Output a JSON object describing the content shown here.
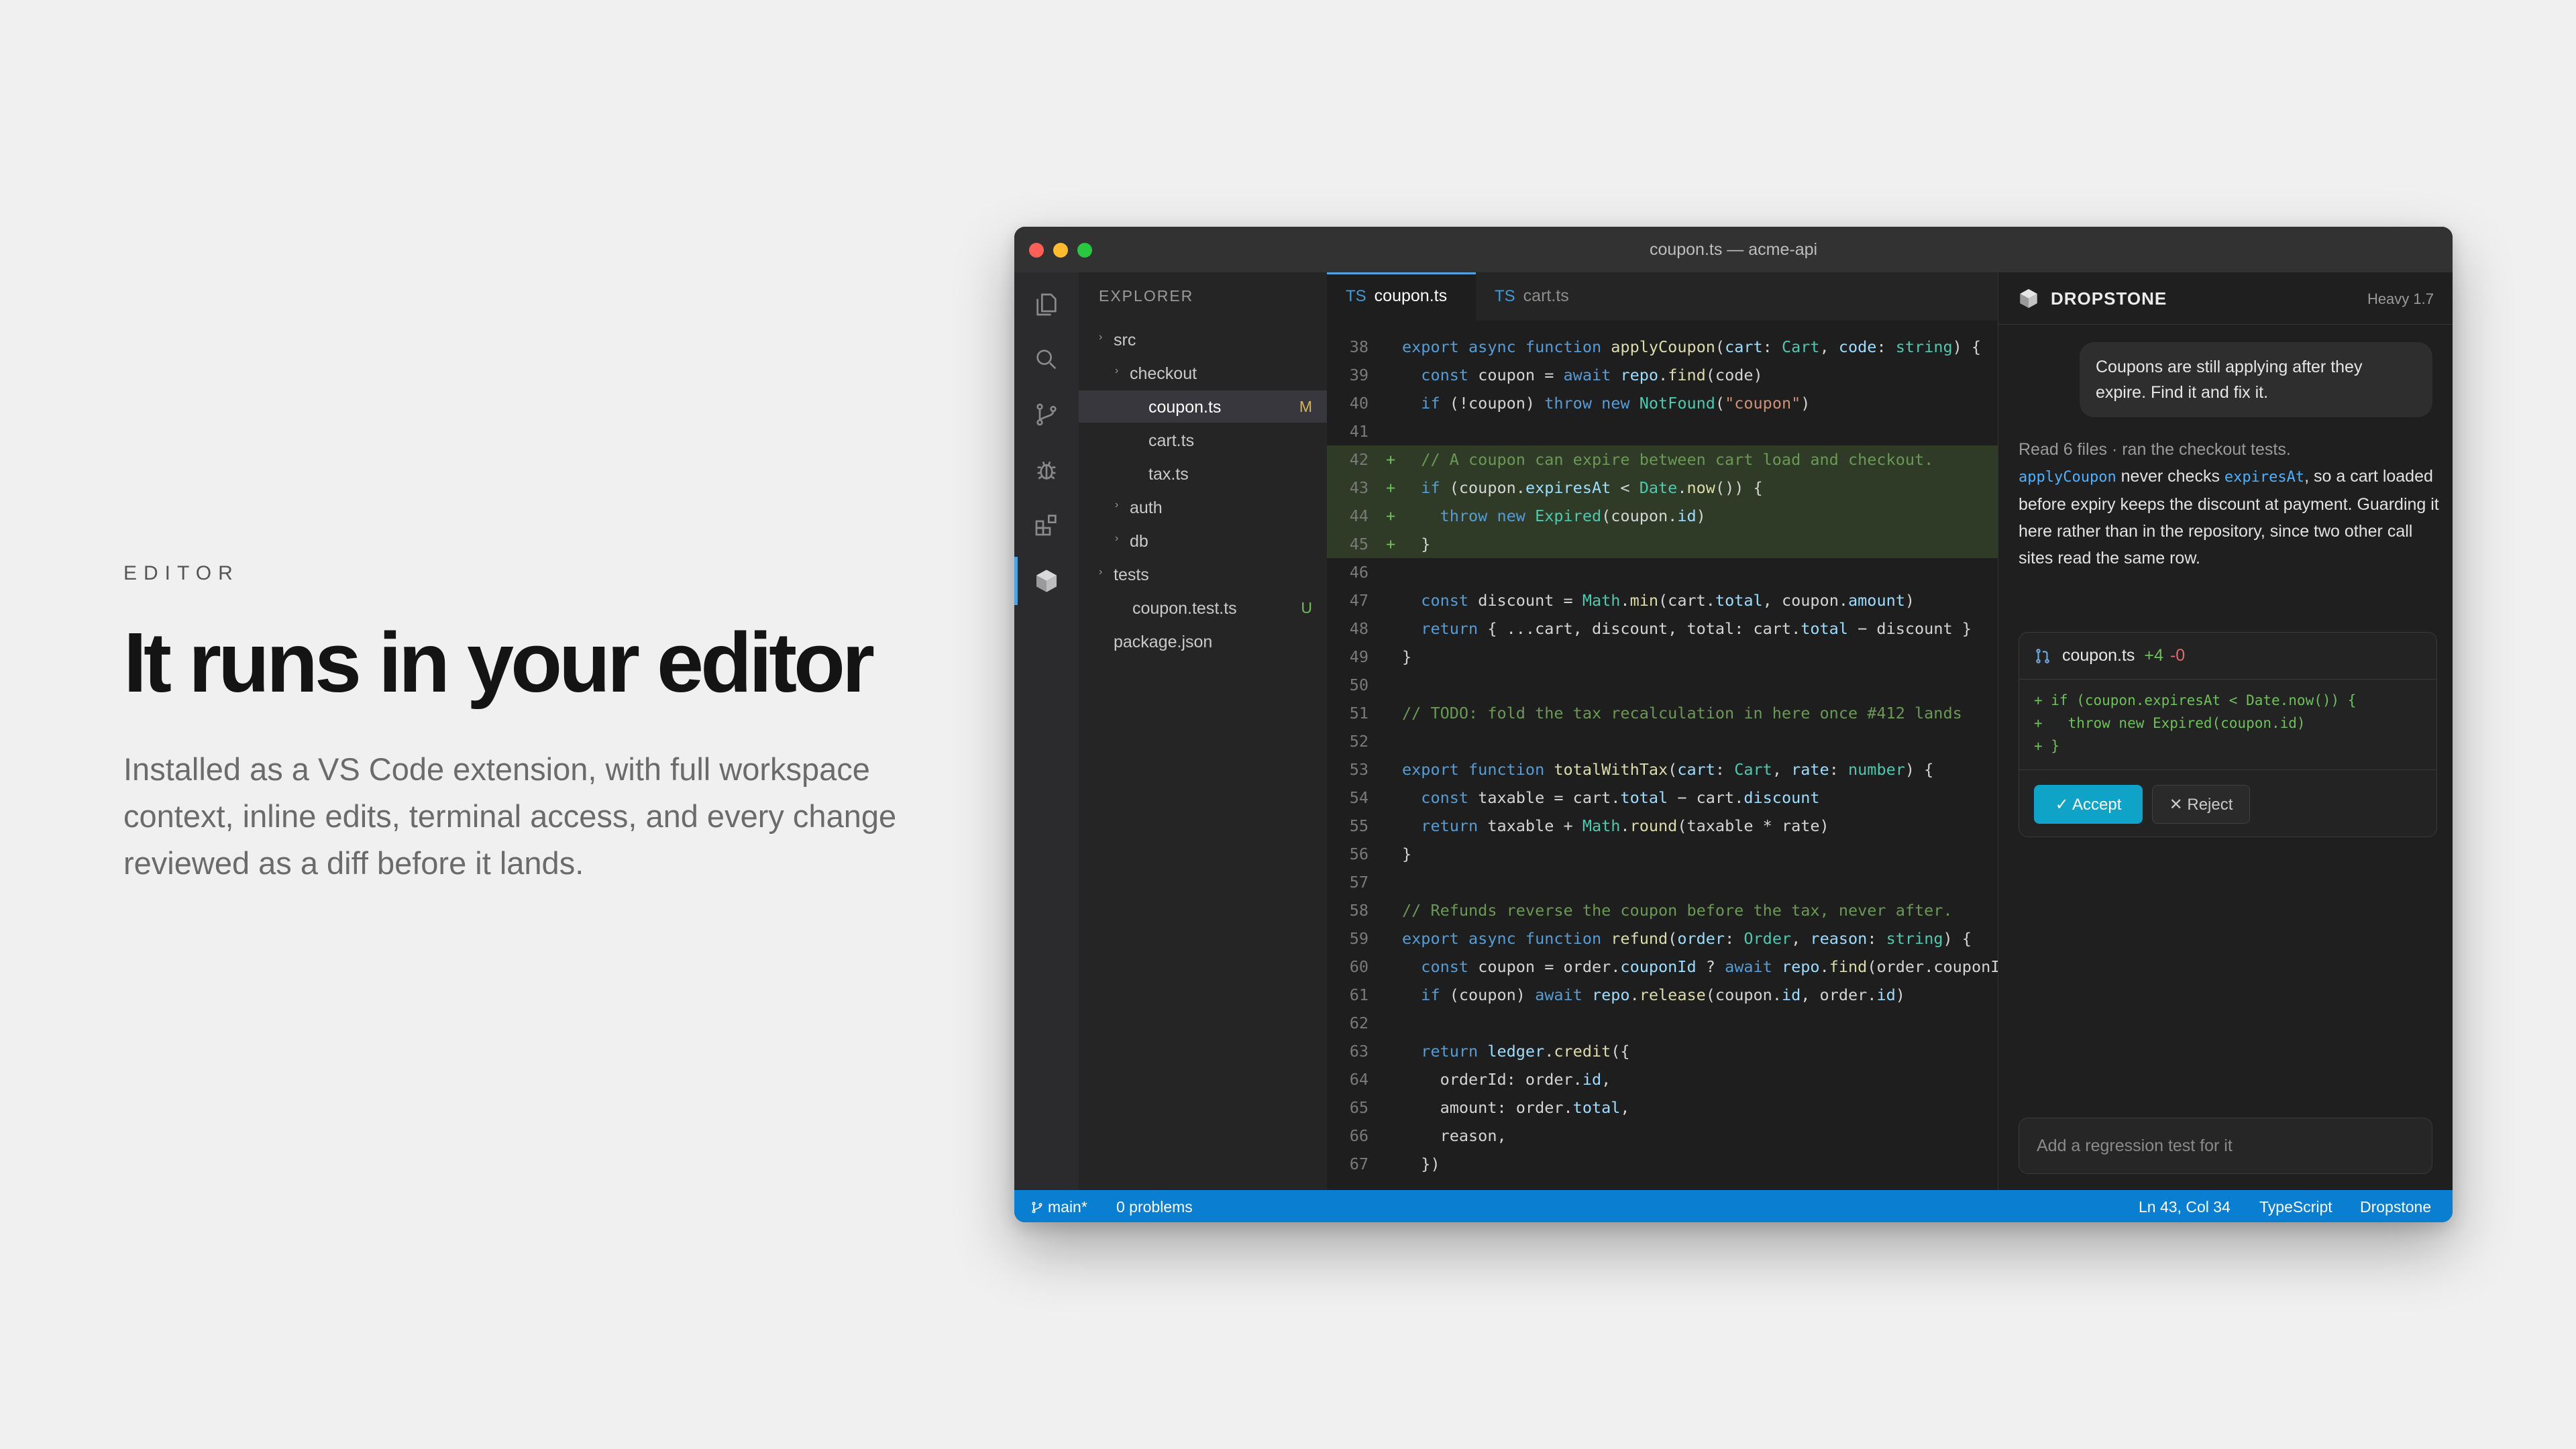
{
  "hero": {
    "eyebrow": "EDITOR",
    "title": "It runs in your editor",
    "subtitle": "Installed as a VS Code extension, with full workspace context, inline edits, terminal access, and every change reviewed as a diff before it lands."
  },
  "window": {
    "title": "coupon.ts — acme-api"
  },
  "activity_bar": {
    "icons": [
      "files-icon",
      "search-icon",
      "source-control-icon",
      "debug-icon",
      "extensions-icon",
      "dropstone-icon"
    ]
  },
  "explorer": {
    "label": "EXPLORER",
    "tree": [
      {
        "name": "src",
        "depth": 0,
        "folder": true,
        "badge": ""
      },
      {
        "name": "checkout",
        "depth": 1,
        "folder": true,
        "badge": ""
      },
      {
        "name": "coupon.ts",
        "depth": 2,
        "folder": false,
        "badge": "M",
        "active": true
      },
      {
        "name": "cart.ts",
        "depth": 2,
        "folder": false,
        "badge": ""
      },
      {
        "name": "tax.ts",
        "depth": 2,
        "folder": false,
        "badge": ""
      },
      {
        "name": "auth",
        "depth": 1,
        "folder": true,
        "badge": ""
      },
      {
        "name": "db",
        "depth": 1,
        "folder": true,
        "badge": ""
      },
      {
        "name": "tests",
        "depth": 0,
        "folder": true,
        "badge": ""
      },
      {
        "name": "coupon.test.ts",
        "depth": 1,
        "folder": false,
        "badge": "U"
      },
      {
        "name": "package.json",
        "depth": 0,
        "folder": false,
        "badge": ""
      }
    ]
  },
  "editor": {
    "tabs": [
      {
        "lang": "TS",
        "label": "coupon.ts"
      },
      {
        "lang": "TS",
        "label": "cart.ts"
      }
    ],
    "lines": [
      {
        "n": "38",
        "added": false,
        "c": "<span class=\"kw\">export async function</span> <span class=\"fn\">applyCoupon</span>(<span class=\"pm\">cart</span>: <span class=\"ty\">Cart</span>, <span class=\"pm\">code</span>: <span class=\"ty\">string</span>) {"
      },
      {
        "n": "39",
        "added": false,
        "c": "  <span class=\"kw\">const</span> coupon = <span class=\"kw\">await</span> <span class=\"pm\">repo</span>.<span class=\"fn\">find</span>(code)"
      },
      {
        "n": "40",
        "added": false,
        "c": "  <span class=\"kw\">if</span> (!coupon) <span class=\"kw\">throw new</span> <span class=\"ty\">NotFound</span>(<span class=\"st\">\"coupon\"</span>)"
      },
      {
        "n": "41",
        "added": false,
        "c": ""
      },
      {
        "n": "42",
        "added": true,
        "c": "  <span class=\"cm\">// A coupon can expire between cart load and checkout.</span>"
      },
      {
        "n": "43",
        "added": true,
        "c": "  <span class=\"kw\">if</span> (coupon.<span class=\"pm\">expiresAt</span> &lt; <span class=\"ty\">Date</span>.<span class=\"fn\">now</span>()) {"
      },
      {
        "n": "44",
        "added": true,
        "c": "    <span class=\"kw\">throw new</span> <span class=\"ty\">Expired</span>(coupon.<span class=\"pm\">id</span>)"
      },
      {
        "n": "45",
        "added": true,
        "c": "  }"
      },
      {
        "n": "46",
        "added": false,
        "c": ""
      },
      {
        "n": "47",
        "added": false,
        "c": "  <span class=\"kw\">const</span> discount = <span class=\"ty\">Math</span>.<span class=\"fn\">min</span>(cart.<span class=\"pm\">total</span>, coupon.<span class=\"pm\">amount</span>)"
      },
      {
        "n": "48",
        "added": false,
        "c": "  <span class=\"kw\">return</span> { ...cart, discount, total: cart.<span class=\"pm\">total</span> − discount }"
      },
      {
        "n": "49",
        "added": false,
        "c": "}"
      },
      {
        "n": "50",
        "added": false,
        "c": ""
      },
      {
        "n": "51",
        "added": false,
        "c": "<span class=\"cm\">// TODO: fold the tax recalculation in here once #412 lands</span>"
      },
      {
        "n": "52",
        "added": false,
        "c": ""
      },
      {
        "n": "53",
        "added": false,
        "c": "<span class=\"kw\">export function</span> <span class=\"fn\">totalWithTax</span>(<span class=\"pm\">cart</span>: <span class=\"ty\">Cart</span>, <span class=\"pm\">rate</span>: <span class=\"ty\">number</span>) {"
      },
      {
        "n": "54",
        "added": false,
        "c": "  <span class=\"kw\">const</span> taxable = cart.<span class=\"pm\">total</span> − cart.<span class=\"pm\">discount</span>"
      },
      {
        "n": "55",
        "added": false,
        "c": "  <span class=\"kw\">return</span> taxable + <span class=\"ty\">Math</span>.<span class=\"fn\">round</span>(taxable * rate)"
      },
      {
        "n": "56",
        "added": false,
        "c": "}"
      },
      {
        "n": "57",
        "added": false,
        "c": ""
      },
      {
        "n": "58",
        "added": false,
        "c": "<span class=\"cm\">// Refunds reverse the coupon before the tax, never after.</span>"
      },
      {
        "n": "59",
        "added": false,
        "c": "<span class=\"kw\">export async function</span> <span class=\"fn\">refund</span>(<span class=\"pm\">order</span>: <span class=\"ty\">Order</span>, <span class=\"pm\">reason</span>: <span class=\"ty\">string</span>) {"
      },
      {
        "n": "60",
        "added": false,
        "c": "  <span class=\"kw\">const</span> coupon = order.<span class=\"pm\">couponId</span> ? <span class=\"kw\">await</span> <span class=\"pm\">repo</span>.<span class=\"fn\">find</span>(order.couponId)"
      },
      {
        "n": "61",
        "added": false,
        "c": "  <span class=\"kw\">if</span> (coupon) <span class=\"kw\">await</span> <span class=\"pm\">repo</span>.<span class=\"fn\">release</span>(coupon.<span class=\"pm\">id</span>, order.<span class=\"pm\">id</span>)"
      },
      {
        "n": "62",
        "added": false,
        "c": ""
      },
      {
        "n": "63",
        "added": false,
        "c": "  <span class=\"kw\">return</span> <span class=\"pm\">ledger</span>.<span class=\"fn\">credit</span>({"
      },
      {
        "n": "64",
        "added": false,
        "c": "    orderId: order.<span class=\"pm\">id</span>,"
      },
      {
        "n": "65",
        "added": false,
        "c": "    amount: order.<span class=\"pm\">total</span>,"
      },
      {
        "n": "66",
        "added": false,
        "c": "    reason,"
      },
      {
        "n": "67",
        "added": false,
        "c": "  })"
      }
    ]
  },
  "assistant": {
    "name": "DROPSTONE",
    "model": "Heavy 1.7",
    "user_message": "Coupons are still applying after they expire. Find it and fix it.",
    "reply_meta": "Read 6 files · ran the checkout tests.",
    "reply_code_1": "applyCoupon",
    "reply_text_1": " never checks ",
    "reply_code_2": "expiresAt",
    "reply_text_2": ", so a cart loaded before expiry keeps the discount at payment. Guarding it here rather than in the repository, since two other call sites read the same row.",
    "diff": {
      "file": "coupon.ts",
      "additions": "+4",
      "deletions": "-0",
      "lines": [
        "+ if (coupon.expiresAt < Date.now()) {",
        "+   throw new Expired(coupon.id)",
        "+ }"
      ],
      "accept_label": "Accept",
      "reject_label": "Reject"
    },
    "input_placeholder": "Add a regression test for it"
  },
  "status_bar": {
    "branch": "main*",
    "problems": "0 problems",
    "position": "Ln 43, Col 34",
    "language": "TypeScript",
    "extension": "Dropstone"
  },
  "colors": {
    "accent": "#0a7fd1",
    "accept": "#0fa3c8",
    "added_bg": "#2f3b27"
  }
}
